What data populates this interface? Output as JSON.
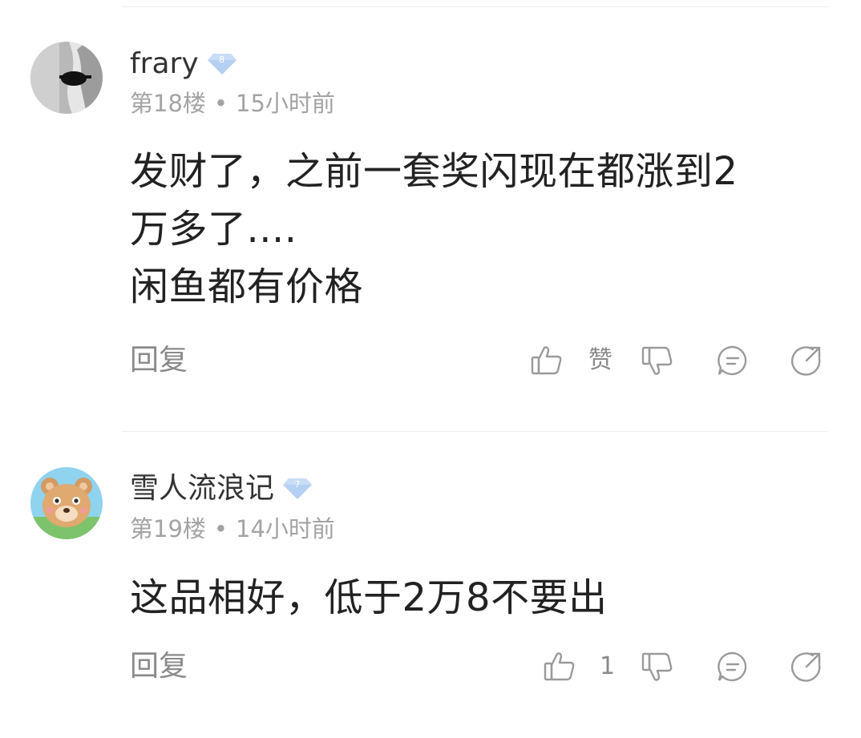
{
  "comments": [
    {
      "username": "frary",
      "level": "8",
      "floor": "第18楼",
      "time": "15小时前",
      "separator": "•",
      "lines": [
        "发财了，之前一套奖闪现在都涨到2",
        "万多了....",
        "闲鱼都有价格"
      ],
      "reply_label": "回复",
      "like_label": "赞",
      "avatar_icon": "sunglasses-avatar"
    },
    {
      "username": "雪人流浪记",
      "level": "7",
      "floor": "第19楼",
      "time": "14小时前",
      "separator": "•",
      "lines": [
        "这品相好，低于2万8不要出"
      ],
      "reply_label": "回复",
      "like_label": "1",
      "avatar_icon": "bear-avatar"
    }
  ],
  "colors": {
    "badge": "#a9c8f0",
    "icon": "#9a9a9a",
    "meta": "#a3a3a3",
    "text": "#222222"
  }
}
